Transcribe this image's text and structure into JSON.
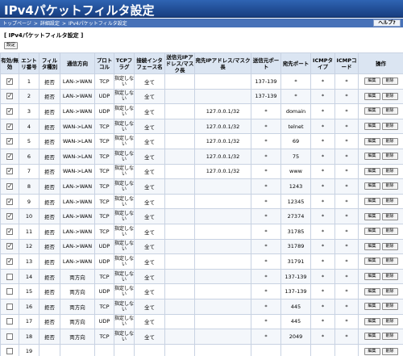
{
  "window": {
    "title": "IPv4パケットフィルタ設定"
  },
  "breadcrumb": {
    "items": [
      "トップページ",
      "詳細設定",
      "IPv4パケットフィルタ設定"
    ],
    "separator": ">"
  },
  "help_label": "ヘルプ?",
  "section_title": "[ IPv4パケットフィルタ設定 ]",
  "set_button": "設定",
  "table": {
    "headers": [
      "有効/無効",
      "エントリ番号",
      "フィルタ種別",
      "通信方向",
      "プロトコル",
      "TCPフラグ",
      "接続インタフェース名",
      "送信元IPアドレス/マスク長",
      "宛先IPアドレス/マスク長",
      "送信元ポート",
      "宛先ポート",
      "ICMPタイプ",
      "ICMPコード",
      "操作"
    ],
    "edit_label": "編集",
    "delete_label": "削除",
    "rows": [
      {
        "enabled": true,
        "no": "1",
        "type": "拒否",
        "dir": "LAN->WAN",
        "proto": "TCP",
        "flag": "指定しない",
        "iface": "全て",
        "src": "",
        "dst": "",
        "sport": "137-139",
        "dport": "*",
        "icmpt": "*",
        "icmpc": "*"
      },
      {
        "enabled": true,
        "no": "2",
        "type": "拒否",
        "dir": "LAN->WAN",
        "proto": "UDP",
        "flag": "指定しない",
        "iface": "全て",
        "src": "",
        "dst": "",
        "sport": "137-139",
        "dport": "*",
        "icmpt": "*",
        "icmpc": "*"
      },
      {
        "enabled": true,
        "no": "3",
        "type": "拒否",
        "dir": "LAN->WAN",
        "proto": "UDP",
        "flag": "指定しない",
        "iface": "全て",
        "src": "",
        "dst": "127.0.0.1/32",
        "sport": "*",
        "dport": "domain",
        "icmpt": "*",
        "icmpc": "*"
      },
      {
        "enabled": true,
        "no": "4",
        "type": "拒否",
        "dir": "WAN->LAN",
        "proto": "TCP",
        "flag": "指定しない",
        "iface": "全て",
        "src": "",
        "dst": "127.0.0.1/32",
        "sport": "*",
        "dport": "telnet",
        "icmpt": "*",
        "icmpc": "*"
      },
      {
        "enabled": true,
        "no": "5",
        "type": "拒否",
        "dir": "WAN->LAN",
        "proto": "TCP",
        "flag": "指定しない",
        "iface": "全て",
        "src": "",
        "dst": "127.0.0.1/32",
        "sport": "*",
        "dport": "69",
        "icmpt": "*",
        "icmpc": "*"
      },
      {
        "enabled": true,
        "no": "6",
        "type": "拒否",
        "dir": "WAN->LAN",
        "proto": "TCP",
        "flag": "指定しない",
        "iface": "全て",
        "src": "",
        "dst": "127.0.0.1/32",
        "sport": "*",
        "dport": "75",
        "icmpt": "*",
        "icmpc": "*"
      },
      {
        "enabled": true,
        "no": "7",
        "type": "拒否",
        "dir": "WAN->LAN",
        "proto": "TCP",
        "flag": "指定しない",
        "iface": "全て",
        "src": "",
        "dst": "127.0.0.1/32",
        "sport": "*",
        "dport": "www",
        "icmpt": "*",
        "icmpc": "*"
      },
      {
        "enabled": true,
        "no": "8",
        "type": "拒否",
        "dir": "LAN->WAN",
        "proto": "TCP",
        "flag": "指定しない",
        "iface": "全て",
        "src": "",
        "dst": "",
        "sport": "*",
        "dport": "1243",
        "icmpt": "*",
        "icmpc": "*"
      },
      {
        "enabled": true,
        "no": "9",
        "type": "拒否",
        "dir": "LAN->WAN",
        "proto": "TCP",
        "flag": "指定しない",
        "iface": "全て",
        "src": "",
        "dst": "",
        "sport": "*",
        "dport": "12345",
        "icmpt": "*",
        "icmpc": "*"
      },
      {
        "enabled": true,
        "no": "10",
        "type": "拒否",
        "dir": "LAN->WAN",
        "proto": "TCP",
        "flag": "指定しない",
        "iface": "全て",
        "src": "",
        "dst": "",
        "sport": "*",
        "dport": "27374",
        "icmpt": "*",
        "icmpc": "*"
      },
      {
        "enabled": true,
        "no": "11",
        "type": "拒否",
        "dir": "LAN->WAN",
        "proto": "TCP",
        "flag": "指定しない",
        "iface": "全て",
        "src": "",
        "dst": "",
        "sport": "*",
        "dport": "31785",
        "icmpt": "*",
        "icmpc": "*"
      },
      {
        "enabled": true,
        "no": "12",
        "type": "拒否",
        "dir": "LAN->WAN",
        "proto": "UDP",
        "flag": "指定しない",
        "iface": "全て",
        "src": "",
        "dst": "",
        "sport": "*",
        "dport": "31789",
        "icmpt": "*",
        "icmpc": "*"
      },
      {
        "enabled": true,
        "no": "13",
        "type": "拒否",
        "dir": "LAN->WAN",
        "proto": "UDP",
        "flag": "指定しない",
        "iface": "全て",
        "src": "",
        "dst": "",
        "sport": "*",
        "dport": "31791",
        "icmpt": "*",
        "icmpc": "*"
      },
      {
        "enabled": false,
        "no": "14",
        "type": "拒否",
        "dir": "両方向",
        "proto": "TCP",
        "flag": "指定しない",
        "iface": "全て",
        "src": "",
        "dst": "",
        "sport": "*",
        "dport": "137-139",
        "icmpt": "*",
        "icmpc": "*"
      },
      {
        "enabled": false,
        "no": "15",
        "type": "拒否",
        "dir": "両方向",
        "proto": "UDP",
        "flag": "指定しない",
        "iface": "全て",
        "src": "",
        "dst": "",
        "sport": "*",
        "dport": "137-139",
        "icmpt": "*",
        "icmpc": "*"
      },
      {
        "enabled": false,
        "no": "16",
        "type": "拒否",
        "dir": "両方向",
        "proto": "TCP",
        "flag": "指定しない",
        "iface": "全て",
        "src": "",
        "dst": "",
        "sport": "*",
        "dport": "445",
        "icmpt": "*",
        "icmpc": "*"
      },
      {
        "enabled": false,
        "no": "17",
        "type": "拒否",
        "dir": "両方向",
        "proto": "UDP",
        "flag": "指定しない",
        "iface": "全て",
        "src": "",
        "dst": "",
        "sport": "*",
        "dport": "445",
        "icmpt": "*",
        "icmpc": "*"
      },
      {
        "enabled": false,
        "no": "18",
        "type": "拒否",
        "dir": "両方向",
        "proto": "TCP",
        "flag": "指定しない",
        "iface": "全て",
        "src": "",
        "dst": "",
        "sport": "*",
        "dport": "2049",
        "icmpt": "*",
        "icmpc": "*"
      },
      {
        "enabled": false,
        "no": "19",
        "type": "",
        "dir": "",
        "proto": "",
        "flag": "",
        "iface": "",
        "src": "",
        "dst": "",
        "sport": "",
        "dport": "",
        "icmpt": "",
        "icmpc": ""
      }
    ]
  },
  "colors": {
    "title_bar": "#1f4a95",
    "nav_bar": "#4872b8",
    "header_bg": "#dbe5f2"
  }
}
